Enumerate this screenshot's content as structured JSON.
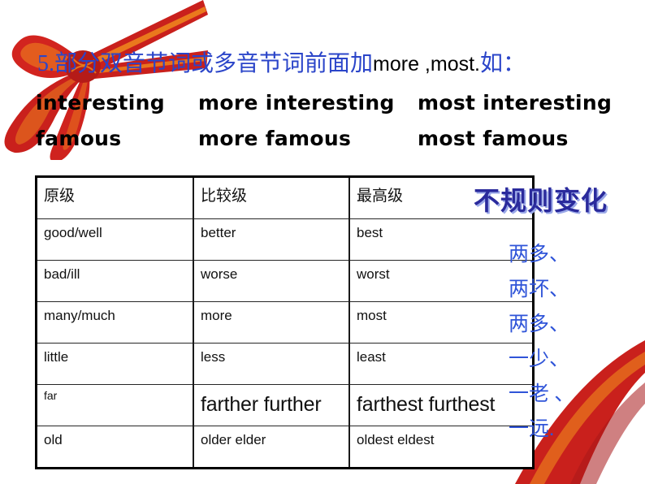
{
  "slide": {
    "heading": {
      "number": "5.",
      "cn_part1": "部分双音节词或多音节词前面加",
      "en_part": "more ,most.",
      "cn_part2": "如："
    },
    "examples": [
      {
        "positive": "interesting",
        "comparative": "more interesting",
        "superlative": "most interesting"
      },
      {
        "positive": "famous",
        "comparative": "more famous",
        "superlative": "most famous"
      }
    ],
    "table": {
      "headers": [
        "原级",
        "比较级",
        "最高级"
      ],
      "rows": [
        {
          "positive": "good/well",
          "comparative": "better",
          "superlative": "best",
          "size": "normal"
        },
        {
          "positive": "bad/ill",
          "comparative": "worse",
          "superlative": "worst",
          "size": "normal"
        },
        {
          "positive": "many/much",
          "comparative": "more",
          "superlative": "most",
          "size": "normal"
        },
        {
          "positive": "little",
          "comparative": "less",
          "superlative": "least",
          "size": "normal"
        },
        {
          "positive": "far",
          "comparative": "farther further",
          "superlative": "farthest  furthest",
          "size": "mixed"
        },
        {
          "positive": "old",
          "comparative": "older elder",
          "superlative": "oldest  eldest",
          "size": "normal"
        }
      ]
    },
    "side": {
      "title": "不规则变化",
      "items": [
        "两多、",
        "两坏、",
        "两多、",
        "一少、",
        "一老 、",
        "一远."
      ]
    },
    "colors": {
      "heading_cn": "#2b45c9",
      "heading_en": "#000000",
      "side_title": "#2a2a9c",
      "side_title_shadow": "#9aa8e8",
      "side_item": "#2f54d8",
      "ribbon_red": "#c9201c",
      "ribbon_gold": "#f08a1d",
      "table_border": "#000000"
    },
    "decorations": [
      {
        "name": "ribbon-bow-decoration",
        "position": "top-left"
      },
      {
        "name": "ribbon-corner-decoration",
        "position": "bottom-right"
      }
    ]
  }
}
